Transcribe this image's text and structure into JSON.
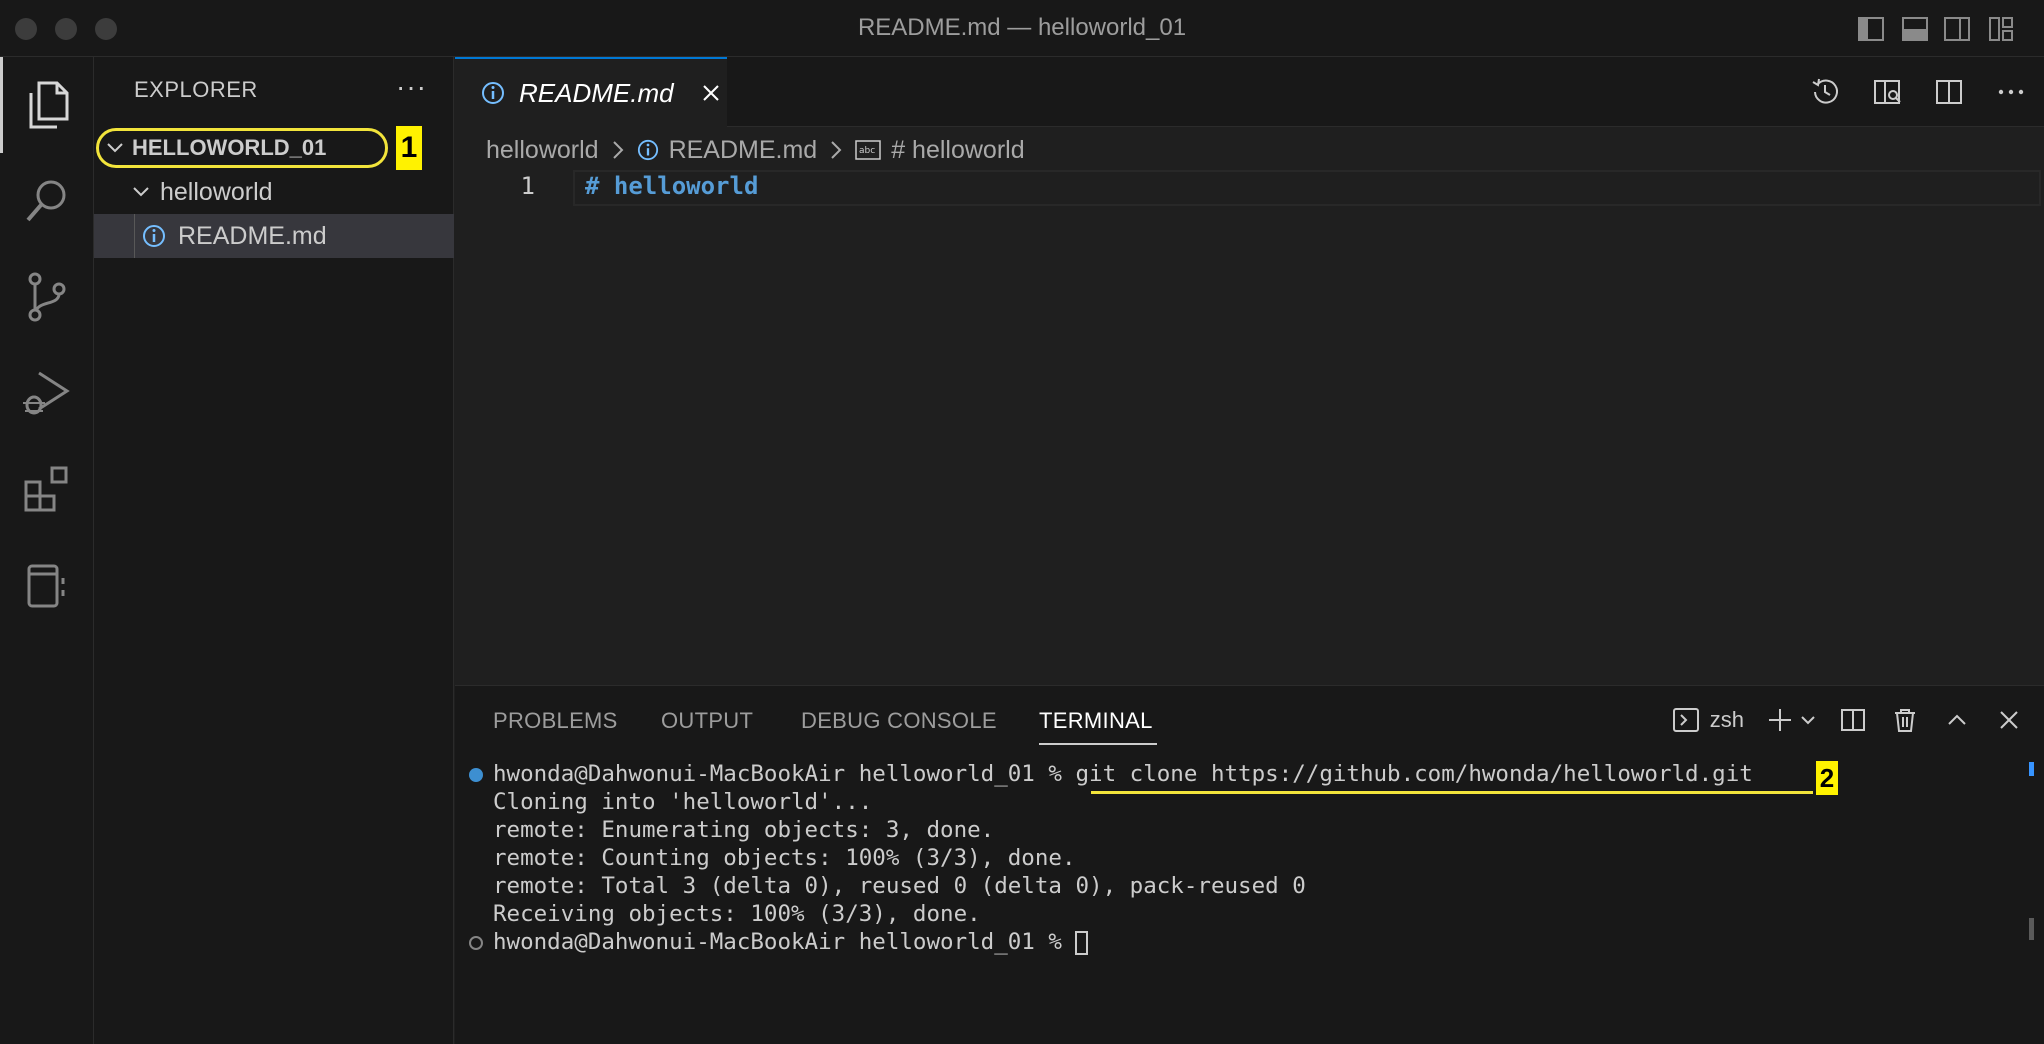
{
  "window": {
    "title": "README.md — helloworld_01",
    "traffic_lights": [
      "close",
      "minimize",
      "zoom"
    ]
  },
  "activity_bar": {
    "items": [
      "explorer-icon",
      "search-icon",
      "source-control-icon",
      "run-debug-icon",
      "extensions-icon",
      "notebook-icon"
    ],
    "active": "explorer-icon"
  },
  "sidebar": {
    "title": "EXPLORER",
    "more": "···",
    "tree": {
      "root": "HELLOWORLD_01",
      "folder": "helloworld",
      "file": "README.md"
    },
    "annotation_1": "1"
  },
  "editor": {
    "tab_label": "README.md",
    "breadcrumbs": [
      "helloworld",
      "README.md",
      "# helloworld"
    ],
    "line_number": "1",
    "line_text": "# helloworld"
  },
  "panel": {
    "tabs": [
      "PROBLEMS",
      "OUTPUT",
      "DEBUG CONSOLE",
      "TERMINAL"
    ],
    "active_tab": "TERMINAL",
    "shell": "zsh",
    "terminal": {
      "prompt": "hwonda@Dahwonui-MacBookAir helloworld_01 % ",
      "command": "git clone https://github.com/hwonda/helloworld.git",
      "output": [
        "Cloning into 'helloworld'...",
        "remote: Enumerating objects: 3, done.",
        "remote: Counting objects: 100% (3/3), done.",
        "remote: Total 3 (delta 0), reused 0 (delta 0), pack-reused 0",
        "Receiving objects: 100% (3/3), done."
      ],
      "prompt2": "hwonda@Dahwonui-MacBookAir helloworld_01 % "
    },
    "annotation_2": "2"
  },
  "colors": {
    "accent": "#0078d4",
    "annotation": "#fff200",
    "heading": "#569cd6"
  }
}
